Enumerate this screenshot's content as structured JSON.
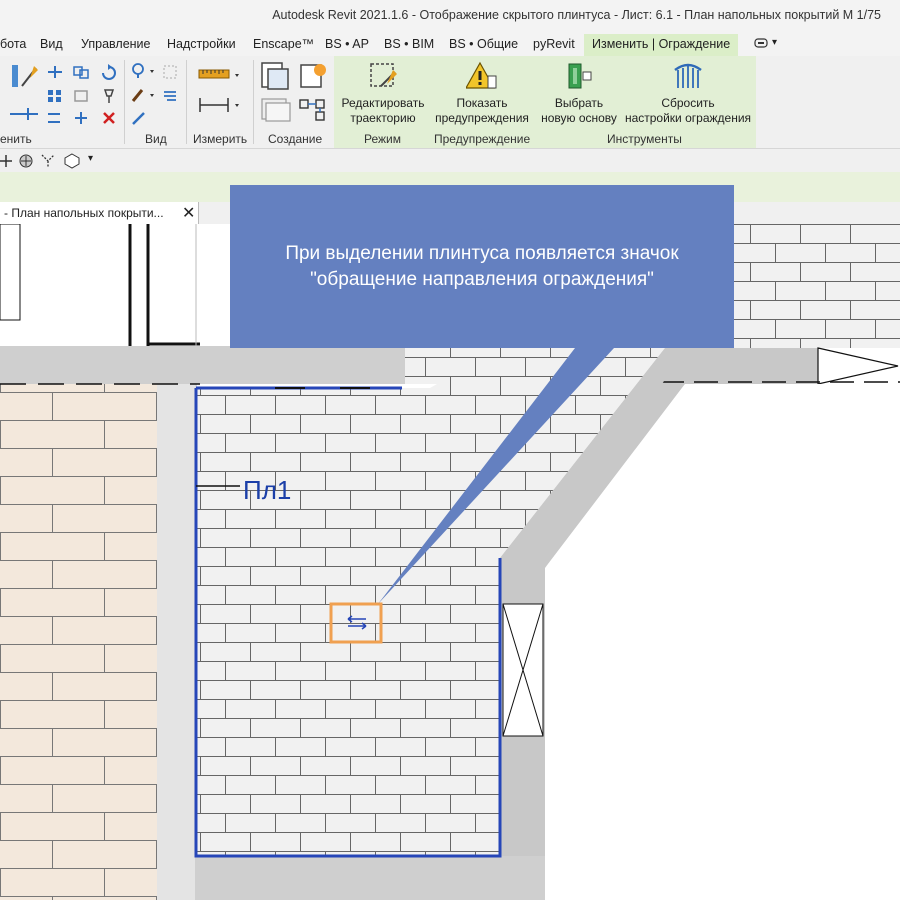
{
  "window": {
    "title": "Autodesk Revit 2021.1.6 - Отображение скрытого плинтуса - Лист: 6.1 - План напольных покрытий М 1/75"
  },
  "menu": {
    "tabs": [
      {
        "label": "бота",
        "active": false
      },
      {
        "label": "Вид",
        "active": false
      },
      {
        "label": "Управление",
        "active": false
      },
      {
        "label": "Надстройки",
        "active": false
      },
      {
        "label": "Enscape™",
        "active": false
      },
      {
        "label": "BS • AP",
        "active": false
      },
      {
        "label": "BS • BIM",
        "active": false
      },
      {
        "label": "BS • Общие",
        "active": false
      },
      {
        "label": "pyRevit",
        "active": false
      },
      {
        "label": "Изменить | Ограждение",
        "active": true
      }
    ],
    "overflow_glyph": "▾"
  },
  "ribbon": {
    "panels": {
      "modify": "енить",
      "view": "Вид",
      "measure": "Измерить",
      "create": "Создание",
      "mode": "Режим",
      "warnings": "Предупреждение",
      "tools": "Инструменты"
    },
    "buttons": {
      "edit_path": {
        "line1": "Редактировать",
        "line2": "траекторию"
      },
      "show_warnings": {
        "line1": "Показать",
        "line2": "предупреждения"
      },
      "pick_host": {
        "line1": "Выбрать",
        "line2": "новую основу"
      },
      "reset_rail": {
        "line1": "Сбросить",
        "line2": "настройки ограждения"
      }
    }
  },
  "view_tab": {
    "label": "- План напольных покрыти...",
    "close": "✕"
  },
  "callout": {
    "line1": "При выделении плинтуса появляется значок",
    "line2": "\"обращение направления ограждения\""
  },
  "drawing": {
    "room_tag": "Пл1",
    "flip_icon": "flip-direction-icon"
  },
  "colors": {
    "ribbon_active": "#dbeec8",
    "callout": "#6480c0",
    "selection": "#2646b8",
    "highlight": "#f0a050",
    "wall": "#c8c8c8",
    "tile_warm": "#f3e8dc"
  }
}
